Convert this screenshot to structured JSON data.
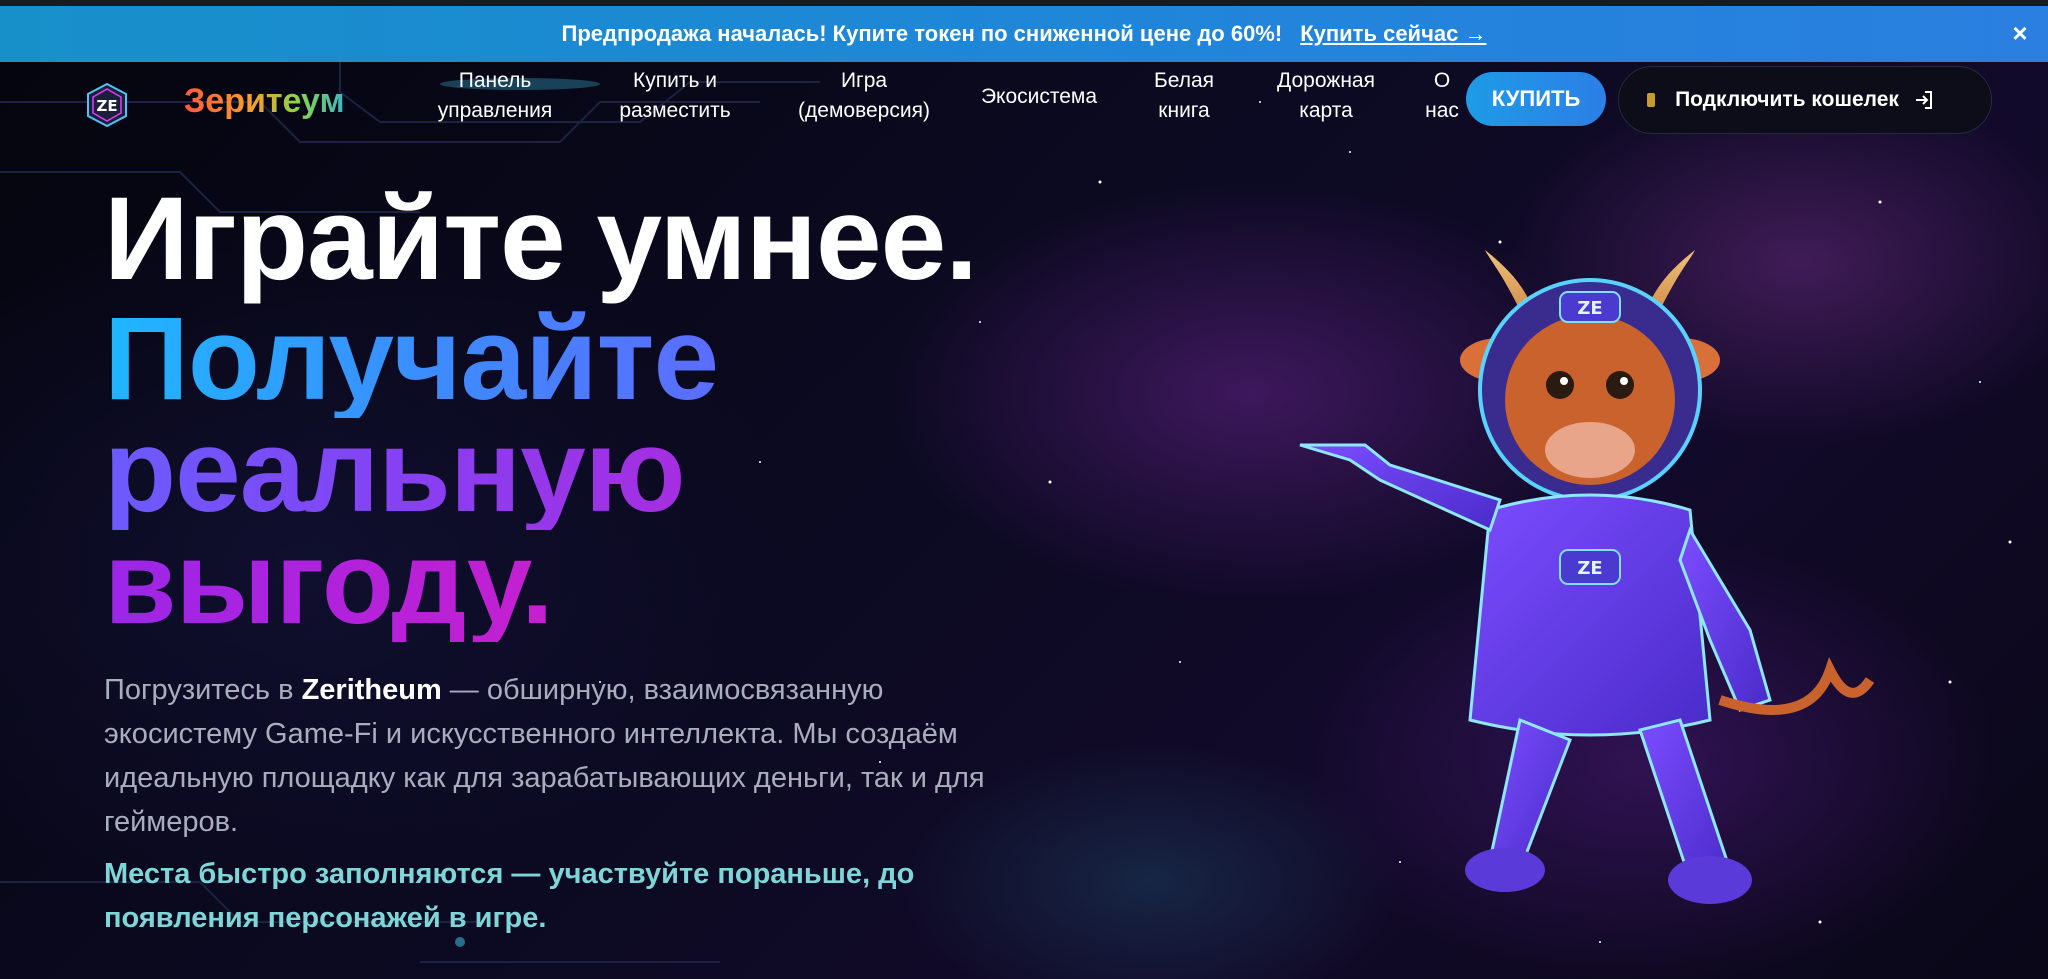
{
  "promo": {
    "text": "Предпродажа началась! Купите токен по сниженной цене до 60%!",
    "link": "Купить сейчас →",
    "close": "×"
  },
  "nav": {
    "brand": "Зеритеум",
    "items": [
      {
        "l1": "Панель",
        "l2": "управления"
      },
      {
        "l1": "Купить и",
        "l2": "разместить"
      },
      {
        "l1": "Игра",
        "l2": "(демоверсия)"
      },
      {
        "l1": "Экосистема",
        "l2": ""
      },
      {
        "l1": "Белая",
        "l2": "книга"
      },
      {
        "l1": "Дорожная",
        "l2": "карта"
      },
      {
        "l1": "О",
        "l2": "нас"
      }
    ],
    "buy": "КУПИТЬ",
    "wallet": "Подключить кошелек"
  },
  "hero": {
    "line1": "Играйте умнее.",
    "line2": "Получайте",
    "line3": "реальную",
    "line4": "выгоду.",
    "desc_prefix": "Погрузитесь в ",
    "desc_brand": "Zeritheum",
    "desc_rest": " — обширную, взаимосвязанную экосистему Game-Fi и искусственного интеллекта. Мы создаём идеальную площадку как для зарабатывающих деньги, так и для геймеров.",
    "cta": "Места быстро заполняются — участвуйте пораньше, до появления персонажей в игре.",
    "mascot_badge": "ZE"
  },
  "colors": {
    "promo_bg": "#1f86d8",
    "accent_blue": "#1e9be6",
    "accent_purple": "#8b3df0",
    "bg": "#070611"
  }
}
